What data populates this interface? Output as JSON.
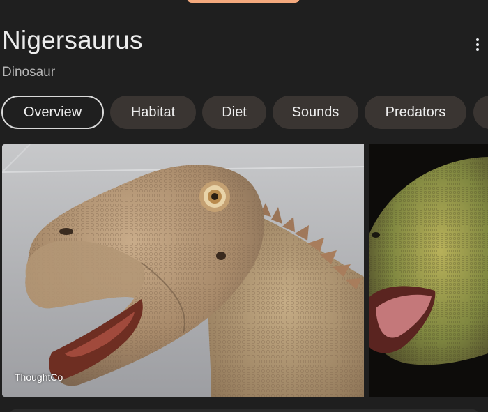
{
  "entity": {
    "title": "Nigersaurus",
    "subtitle": "Dinosaur"
  },
  "tabs": [
    {
      "label": "Overview",
      "active": true
    },
    {
      "label": "Habitat",
      "active": false
    },
    {
      "label": "Diet",
      "active": false
    },
    {
      "label": "Sounds",
      "active": false
    },
    {
      "label": "Predators",
      "active": false
    }
  ],
  "images": [
    {
      "source": "ThoughtCo"
    }
  ],
  "icons": {
    "more": "more-vertical-icon"
  },
  "colors": {
    "background": "#1f1f1f",
    "chip": "#3a3532",
    "accent_pill": "#f4a97d"
  }
}
